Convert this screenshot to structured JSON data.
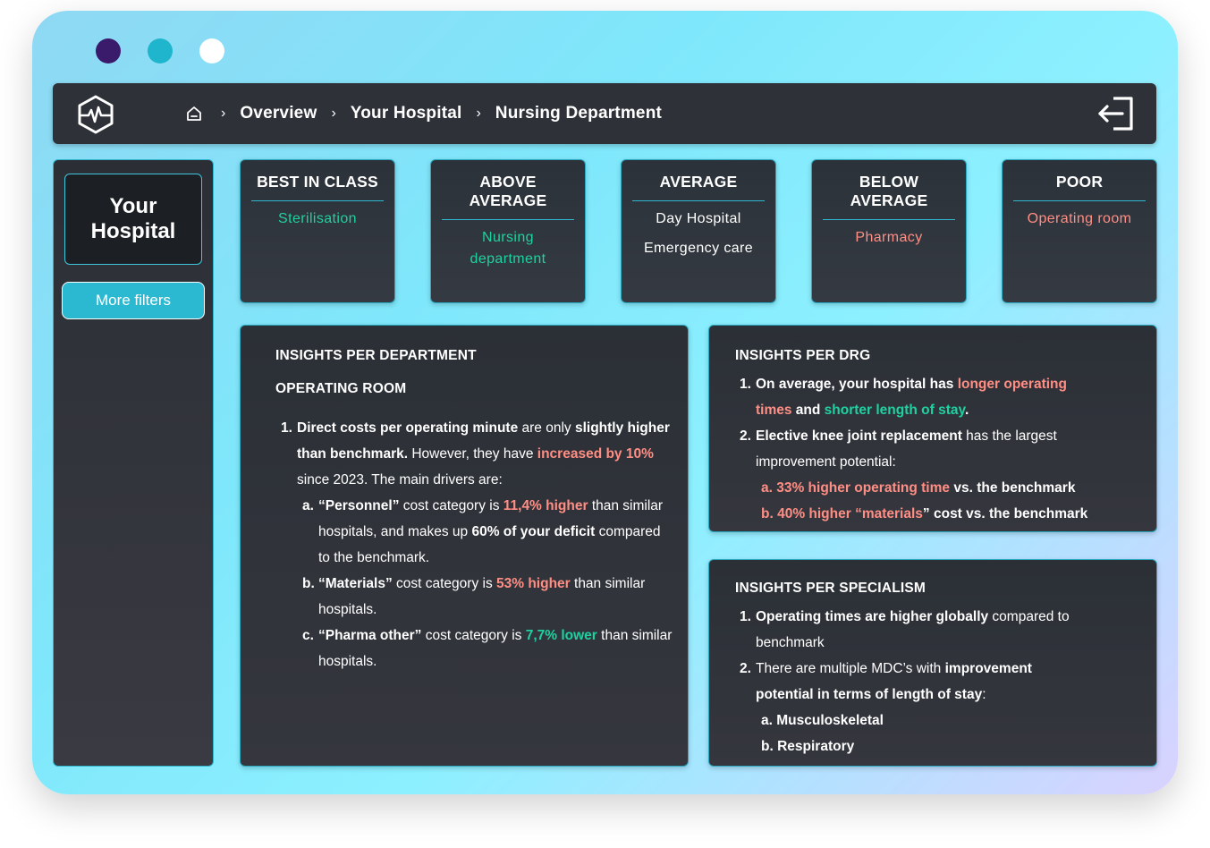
{
  "breadcrumb": [
    "Overview",
    "Your Hospital",
    "Nursing Department"
  ],
  "sidebar": {
    "hospital_label_line1": "Your",
    "hospital_label_line2": "Hospital",
    "more_filters": "More filters"
  },
  "categories": [
    {
      "title": "BEST IN CLASS",
      "items": [
        "Sterilisation"
      ]
    },
    {
      "title": "ABOVE AVERAGE",
      "items": [
        "Nursing",
        "department"
      ]
    },
    {
      "title": "AVERAGE",
      "items": [
        "Day Hospital",
        "Emergency care"
      ]
    },
    {
      "title": "BELOW AVERAGE",
      "items": [
        "Pharmacy"
      ]
    },
    {
      "title": "POOR",
      "items": [
        "Operating room"
      ]
    }
  ],
  "colors": {
    "accent": "#2bb8d1",
    "positive": "#1fd1a0",
    "negative": "#ff8e84",
    "panel": "#2e3238"
  },
  "dept": {
    "title": "INSIGHTS PER DEPARTMENT",
    "subtitle": "OPERATING ROOM",
    "n1": "1.",
    "l1_a": "Direct costs per operating minute",
    "l1_b": " are only ",
    "l1_c": "slightly higher",
    "l2_a": "than benchmark.",
    "l2_b": " However, they have ",
    "l2_c": "increased by 10%",
    "l3": "since 2023. The main drivers are:",
    "na": "a.",
    "a1_a": "“Personnel”",
    "a1_b": " cost category  is ",
    "a1_c": "11,4% higher",
    "a1_d": " than similar",
    "a2_a": "hospitals, and makes up ",
    "a2_b": "60% of your deficit",
    "a2_c": " compared",
    "a3": "to the benchmark.",
    "nb": "b.",
    "b1_a": "“Materials”",
    "b1_b": " cost category is ",
    "b1_c": "53% higher",
    "b1_d": " than similar",
    "b2": "hospitals.",
    "nc": "c.",
    "c1_a": "“Pharma other”",
    "c1_b": " cost category is ",
    "c1_c": "7,7% lower",
    "c1_d": " than similar",
    "c2": "hospitals."
  },
  "drg": {
    "title": "INSIGHTS PER DRG",
    "n1": "1.",
    "l1_a": "On average, your hospital has ",
    "l1_b": "longer operating",
    "l2_a": "times",
    "l2_b": " and ",
    "l2_c": "shorter length of stay",
    "l2_d": ".",
    "n2": "2.",
    "l3_a": "Elective knee joint replacement",
    "l3_b": " has the largest",
    "l4": "improvement potential:",
    "a": "a. 33% higher operating time",
    "a_rest": " vs. the benchmark",
    "b_pre": "b. 40% higher “",
    "b_mid": "materials",
    "b_post": "”",
    "b_rest": " cost vs. the benchmark"
  },
  "spec": {
    "title": "INSIGHTS PER SPECIALISM",
    "n1": "1.",
    "l1_a": "Operating times are higher globally",
    "l1_b": " compared to",
    "l2": "benchmark",
    "n2": "2.",
    "l3_a": "There are multiple MDC’s with ",
    "l3_b": "improvement",
    "l4_a": "potential in terms of length of stay",
    "l4_b": ":",
    "a": "a. Musculoskeletal",
    "b": "b. Respiratory"
  }
}
